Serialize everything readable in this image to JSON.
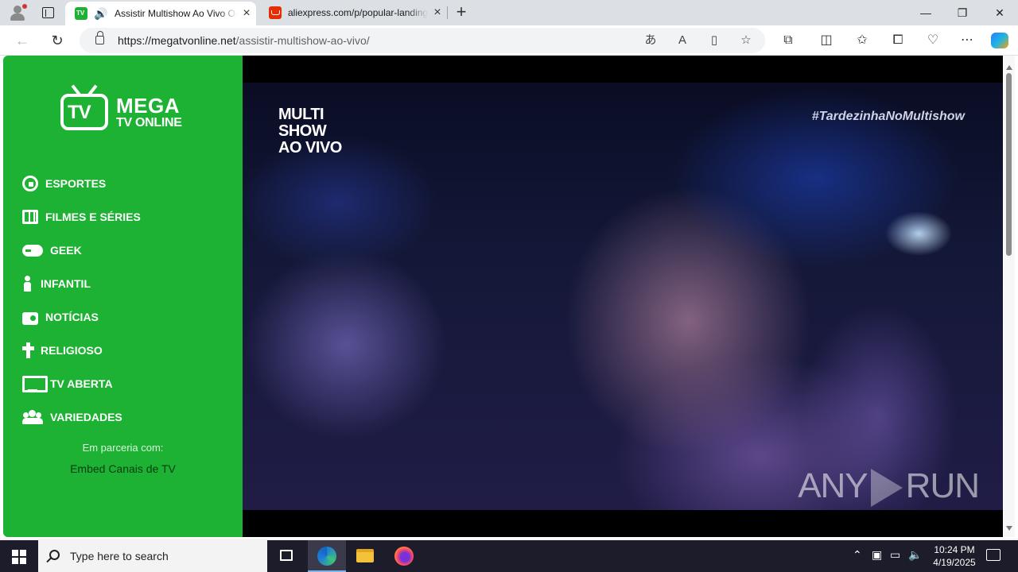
{
  "browser": {
    "tabs": [
      {
        "title": "Assistir Multishow Ao Vivo Onl",
        "active": true
      },
      {
        "title": "aliexpress.com/p/popular-landing",
        "active": false
      }
    ],
    "url": {
      "host": "https://megatvonline.net",
      "path": "/assistir-multishow-ao-vivo/"
    },
    "window_controls": {
      "minimize": "—",
      "maximize": "❐",
      "close": "✕"
    }
  },
  "sidebar": {
    "logo": {
      "mega": "MEGA",
      "tvonline": "TV ONLINE",
      "badge": "TV"
    },
    "menu": [
      {
        "label": "ESPORTES",
        "icon": "soccer-ball-icon"
      },
      {
        "label": "FILMES E SÉRIES",
        "icon": "film-icon"
      },
      {
        "label": "GEEK",
        "icon": "gamepad-icon"
      },
      {
        "label": "INFANTIL",
        "icon": "child-icon"
      },
      {
        "label": "NOTÍCIAS",
        "icon": "radio-icon"
      },
      {
        "label": "RELIGIOSO",
        "icon": "cross-icon"
      },
      {
        "label": "TV ABERTA",
        "icon": "tv-icon"
      },
      {
        "label": "VARIEDADES",
        "icon": "users-icon"
      }
    ],
    "partner_label": "Em parceria com:",
    "partner_link": "Embed Canais de TV"
  },
  "player": {
    "channel_logo": [
      "MULTI",
      "SHOW",
      "AO VIVO"
    ],
    "hashtag": "#TardezinhaNoMultishow",
    "watermark_left": "ANY",
    "watermark_right": "RUN"
  },
  "taskbar": {
    "search_placeholder": "Type here to search",
    "time": "10:24 PM",
    "date": "4/19/2025"
  },
  "colors": {
    "sidebar_green": "#1db233",
    "player_bg": "#000000",
    "taskbar": "#1c1c2a"
  }
}
